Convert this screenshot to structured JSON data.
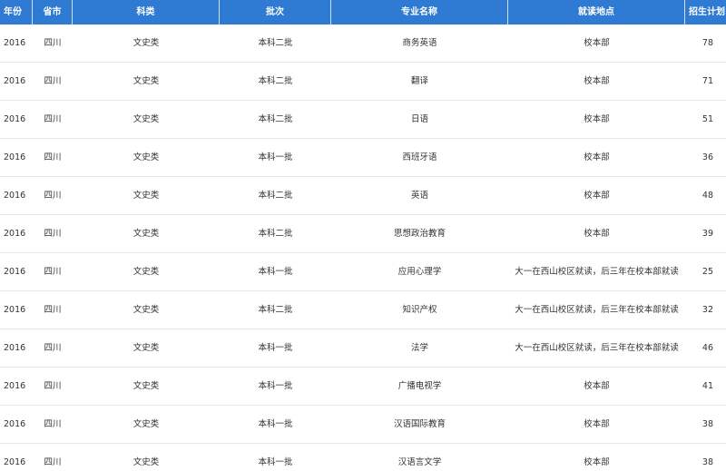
{
  "headers": {
    "year": "年份",
    "province": "省市",
    "category": "科类",
    "batch": "批次",
    "major": "专业名称",
    "location": "就读地点",
    "plan": "招生计划"
  },
  "rows": [
    {
      "year": "2016",
      "province": "四川",
      "category": "文史类",
      "batch": "本科二批",
      "major": "商务英语",
      "location": "校本部",
      "plan": "78"
    },
    {
      "year": "2016",
      "province": "四川",
      "category": "文史类",
      "batch": "本科二批",
      "major": "翻译",
      "location": "校本部",
      "plan": "71"
    },
    {
      "year": "2016",
      "province": "四川",
      "category": "文史类",
      "batch": "本科二批",
      "major": "日语",
      "location": "校本部",
      "plan": "51"
    },
    {
      "year": "2016",
      "province": "四川",
      "category": "文史类",
      "batch": "本科一批",
      "major": "西班牙语",
      "location": "校本部",
      "plan": "36"
    },
    {
      "year": "2016",
      "province": "四川",
      "category": "文史类",
      "batch": "本科二批",
      "major": "英语",
      "location": "校本部",
      "plan": "48"
    },
    {
      "year": "2016",
      "province": "四川",
      "category": "文史类",
      "batch": "本科二批",
      "major": "思想政治教育",
      "location": "校本部",
      "plan": "39"
    },
    {
      "year": "2016",
      "province": "四川",
      "category": "文史类",
      "batch": "本科一批",
      "major": "应用心理学",
      "location": "大一在西山校区就读，后三年在校本部就读",
      "plan": "25"
    },
    {
      "year": "2016",
      "province": "四川",
      "category": "文史类",
      "batch": "本科二批",
      "major": "知识产权",
      "location": "大一在西山校区就读，后三年在校本部就读",
      "plan": "32"
    },
    {
      "year": "2016",
      "province": "四川",
      "category": "文史类",
      "batch": "本科一批",
      "major": "法学",
      "location": "大一在西山校区就读，后三年在校本部就读",
      "plan": "46"
    },
    {
      "year": "2016",
      "province": "四川",
      "category": "文史类",
      "batch": "本科一批",
      "major": "广播电视学",
      "location": "校本部",
      "plan": "41"
    },
    {
      "year": "2016",
      "province": "四川",
      "category": "文史类",
      "batch": "本科一批",
      "major": "汉语国际教育",
      "location": "校本部",
      "plan": "38"
    },
    {
      "year": "2016",
      "province": "四川",
      "category": "文史类",
      "batch": "本科一批",
      "major": "汉语言文学",
      "location": "校本部",
      "plan": "38"
    }
  ]
}
